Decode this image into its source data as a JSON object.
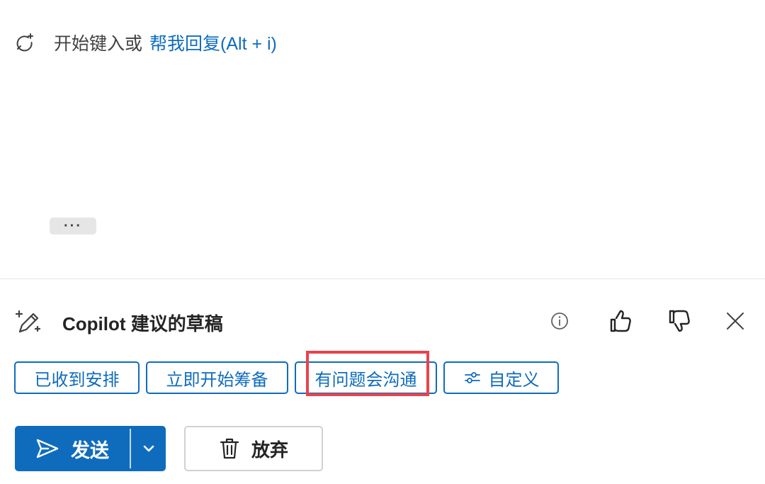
{
  "compose": {
    "prompt_text": "开始键入或",
    "help_link": "帮我回复(Alt + i)",
    "icon": "sparkle-refresh-icon"
  },
  "more_button": {
    "label": "···"
  },
  "copilot": {
    "title": "Copilot 建议的草稿",
    "header_icon": "pen-sparkle-icon",
    "actions": [
      "info-icon",
      "thumbs-up-icon",
      "thumbs-down-icon",
      "close-icon"
    ]
  },
  "suggestions": [
    {
      "label": "已收到安排"
    },
    {
      "label": "立即开始筹备"
    },
    {
      "label": "有问题会沟通",
      "highlighted": true
    },
    {
      "label": "自定义",
      "icon": "sliders-icon"
    }
  ],
  "buttons": {
    "send_label": "发送",
    "send_icon": "send-icon",
    "send_dropdown_icon": "chevron-down-icon",
    "discard_label": "放弃",
    "discard_icon": "trash-icon"
  },
  "colors": {
    "accent": "#0f6cbd",
    "highlight": "#e8434d",
    "text": "#242424"
  }
}
